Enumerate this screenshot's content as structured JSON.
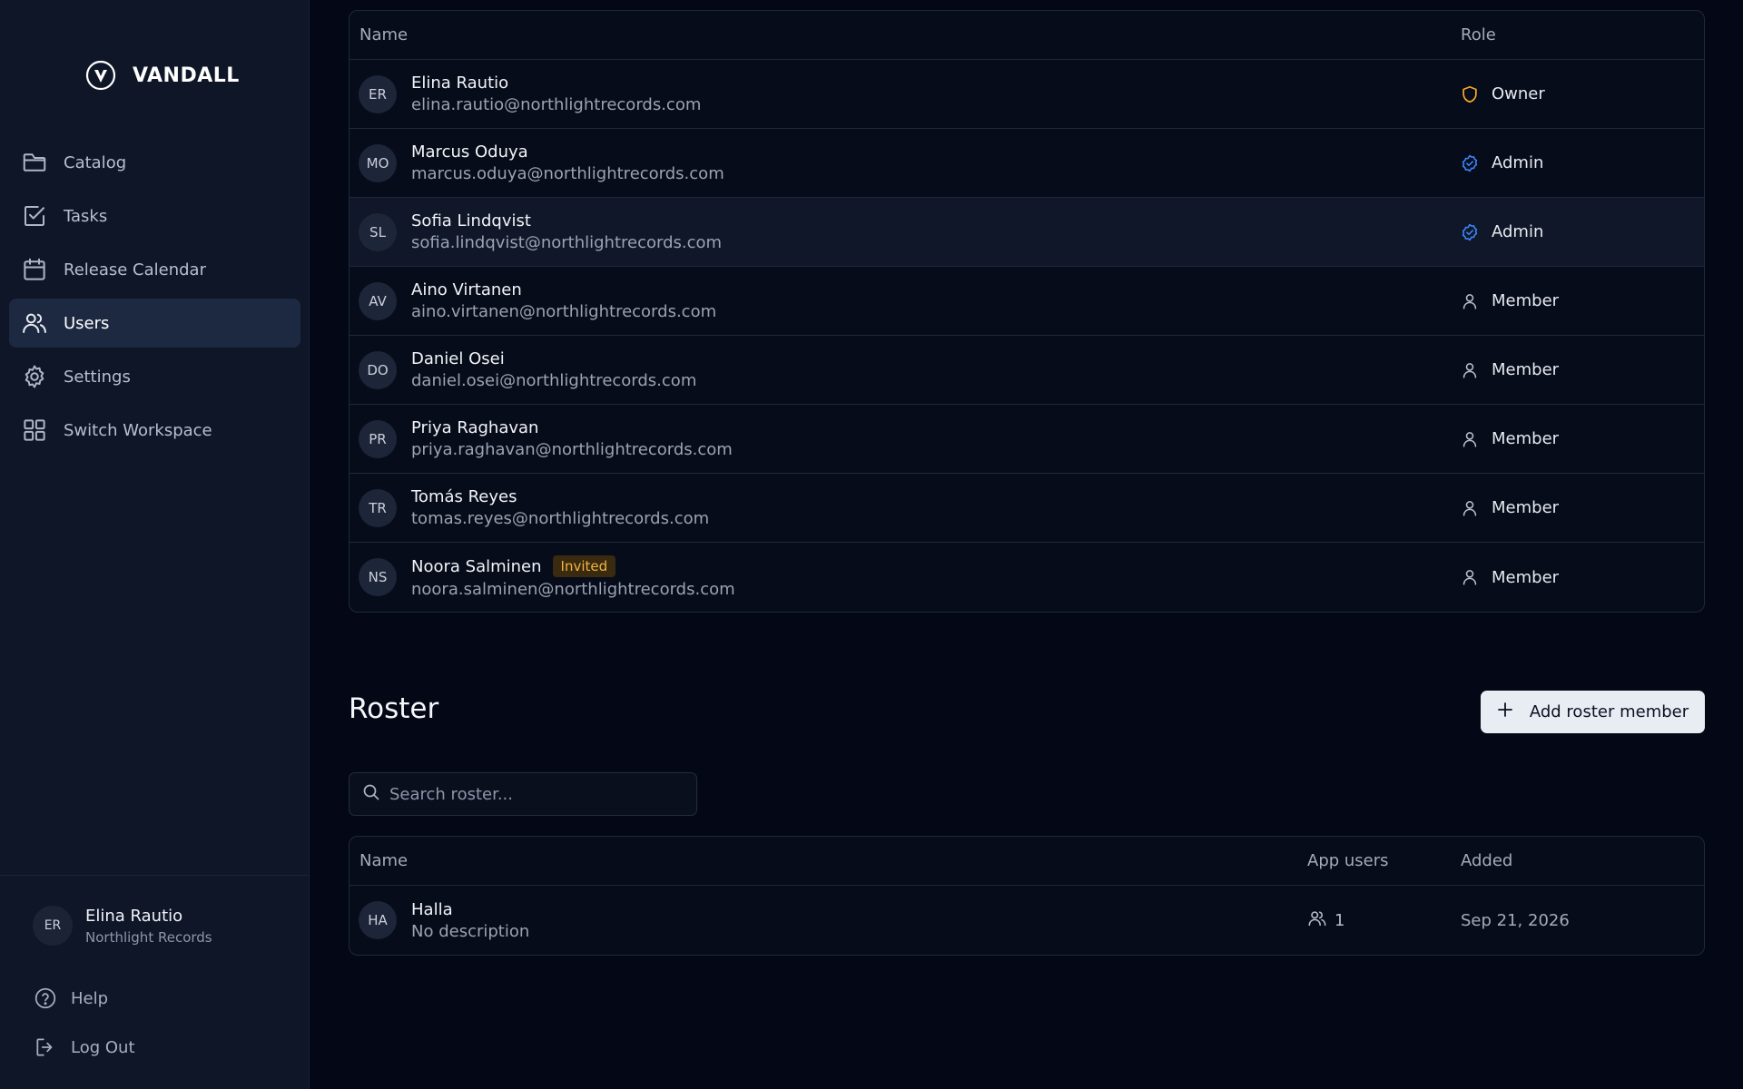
{
  "brand": {
    "name": "VANDALL"
  },
  "nav": [
    {
      "label": "Catalog",
      "icon": "folder-icon",
      "active": false
    },
    {
      "label": "Tasks",
      "icon": "checkbox-icon",
      "active": false
    },
    {
      "label": "Release Calendar",
      "icon": "calendar-icon",
      "active": false
    },
    {
      "label": "Users",
      "icon": "users-icon",
      "active": true
    },
    {
      "label": "Settings",
      "icon": "gear-icon",
      "active": false
    },
    {
      "label": "Switch Workspace",
      "icon": "grid-icon",
      "active": false
    }
  ],
  "profile": {
    "initials": "ER",
    "name": "Elina Rautio",
    "org": "Northlight Records"
  },
  "footer": {
    "help": "Help",
    "logout": "Log Out"
  },
  "users_table": {
    "headers": {
      "name": "Name",
      "role": "Role"
    },
    "rows": [
      {
        "initials": "ER",
        "name": "Elina Rautio",
        "email": "elina.rautio@northlightrecords.com",
        "role": "Owner",
        "role_icon": "shield-icon",
        "badge": ""
      },
      {
        "initials": "MO",
        "name": "Marcus Oduya",
        "email": "marcus.oduya@northlightrecords.com",
        "role": "Admin",
        "role_icon": "badge-check-icon",
        "badge": ""
      },
      {
        "initials": "SL",
        "name": "Sofia Lindqvist",
        "email": "sofia.lindqvist@northlightrecords.com",
        "role": "Admin",
        "role_icon": "badge-check-icon",
        "badge": ""
      },
      {
        "initials": "AV",
        "name": "Aino Virtanen",
        "email": "aino.virtanen@northlightrecords.com",
        "role": "Member",
        "role_icon": "user-icon",
        "badge": ""
      },
      {
        "initials": "DO",
        "name": "Daniel Osei",
        "email": "daniel.osei@northlightrecords.com",
        "role": "Member",
        "role_icon": "user-icon",
        "badge": ""
      },
      {
        "initials": "PR",
        "name": "Priya Raghavan",
        "email": "priya.raghavan@northlightrecords.com",
        "role": "Member",
        "role_icon": "user-icon",
        "badge": ""
      },
      {
        "initials": "TR",
        "name": "Tomás Reyes",
        "email": "tomas.reyes@northlightrecords.com",
        "role": "Member",
        "role_icon": "user-icon",
        "badge": ""
      },
      {
        "initials": "NS",
        "name": "Noora Salminen",
        "email": "noora.salminen@northlightrecords.com",
        "role": "Member",
        "role_icon": "user-icon",
        "badge": "Invited"
      }
    ]
  },
  "roster": {
    "title": "Roster",
    "add_button": "Add roster member",
    "search_placeholder": "Search roster...",
    "headers": {
      "name": "Name",
      "app_users": "App users",
      "added": "Added"
    },
    "rows": [
      {
        "initials": "HA",
        "name": "Halla",
        "description": "No description",
        "app_users": "1",
        "added": "Sep 21, 2026"
      }
    ]
  },
  "colors": {
    "owner": "#f5a623",
    "admin": "#3b82f6",
    "invited_badge": "#f0b441",
    "active_nav": "#1d2940"
  }
}
